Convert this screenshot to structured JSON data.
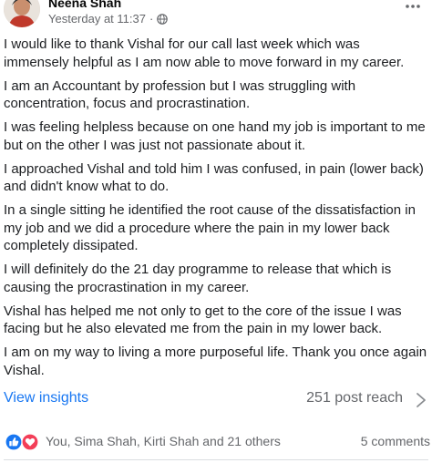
{
  "post": {
    "author": "Neena Shah",
    "timestamp": "Yesterday at 11:37",
    "separator": "·",
    "privacy_icon": "globe-icon",
    "more_icon": "more-options-icon",
    "paragraphs": [
      "I would like to thank Vishal for our call last week which was immensely helpful as I am now able to move forward in my career.",
      "I am an Accountant by profession but I was struggling with concentration, focus and procrastination.",
      "I was feeling helpless because on one hand my job is important to me but on the other I was just not passionate about it.",
      "I approached Vishal and told him I was confused, in pain (lower back) and didn't know what to do.",
      "In a single sitting he identified the root cause of the dissatisfaction in my job and we did a procedure where the pain in my lower back completely dissipated.",
      "I will definitely do the 21 day programme to release that which is causing the procrastination in my career.",
      "Vishal has helped me not only to get to the core of the issue I was facing but he also elevated me from the pain in my lower back.",
      "I am on my way to living a more purposeful life.  Thank you once again Vishal."
    ]
  },
  "insights": {
    "view_label": "View insights",
    "reach_label": "251 post reach"
  },
  "reactions": {
    "icons": [
      "like-icon",
      "love-icon"
    ],
    "names": "You, Sima Shah, Kirti Shah and 21 others",
    "comments_label": "5 comments"
  },
  "colors": {
    "link_blue": "#1877f2",
    "secondary_text": "#65676b",
    "love_red": "#f33e58"
  }
}
